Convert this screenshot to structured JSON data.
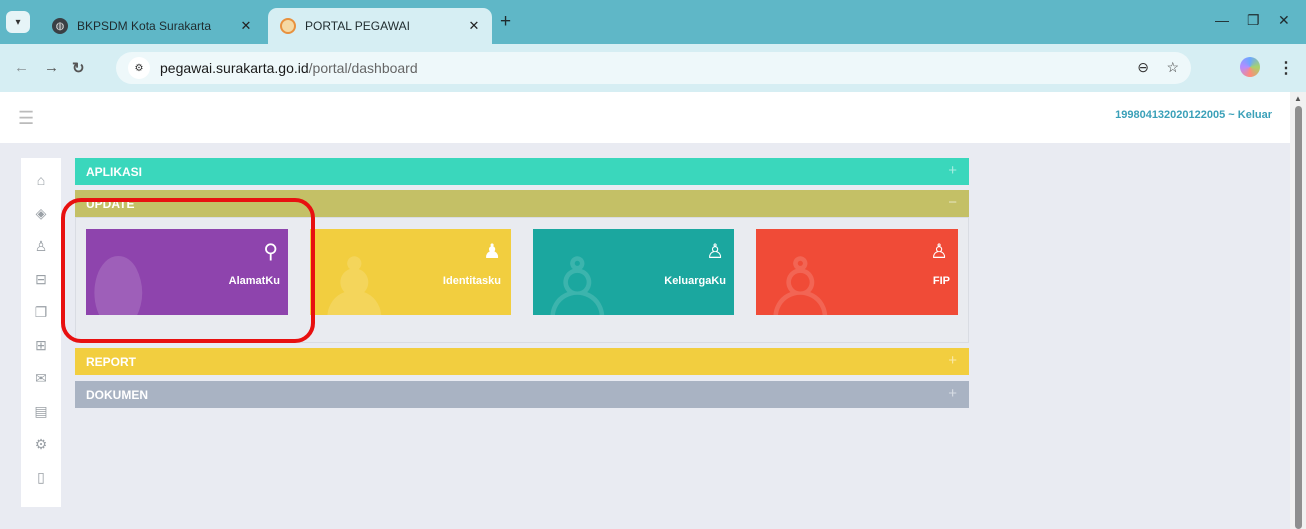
{
  "browser": {
    "tabs": [
      {
        "title": "BKPSDM Kota Surakarta",
        "active": false
      },
      {
        "title": "PORTAL PEGAWAI",
        "active": true
      }
    ],
    "url_host": "pegawai.surakarta.go.id",
    "url_path": "/portal/dashboard"
  },
  "header": {
    "user_link": "199804132020122005 ~ Keluar"
  },
  "sidebar": {
    "icons": [
      "home-icon",
      "layers-icon",
      "user-icon",
      "briefcase-icon",
      "copy-icon",
      "grid-icon",
      "mail-icon",
      "book-icon",
      "settings-icon",
      "door-icon"
    ]
  },
  "panels": [
    {
      "title": "APLIKASI",
      "toggle": "+",
      "color": "#3ad7bc"
    },
    {
      "title": "UPDATE",
      "toggle": "−",
      "color": "#c4c066"
    },
    {
      "title": "REPORT",
      "toggle": "+",
      "color": "#f2ce3f"
    },
    {
      "title": "DOKUMEN",
      "toggle": "+",
      "color": "#a9b3c3"
    }
  ],
  "tiles": [
    {
      "label": "AlamatKu",
      "icon": "map-marker-icon",
      "color": "#8e44ad"
    },
    {
      "label": "Identitasku",
      "icon": "person-icon",
      "color": "#f2ce3f"
    },
    {
      "label": "KeluargaKu",
      "icon": "users-icon",
      "color": "#1ba79f"
    },
    {
      "label": "FIP",
      "icon": "user-plus-icon",
      "color": "#f04b37"
    }
  ],
  "highlight_color": "#e81010"
}
